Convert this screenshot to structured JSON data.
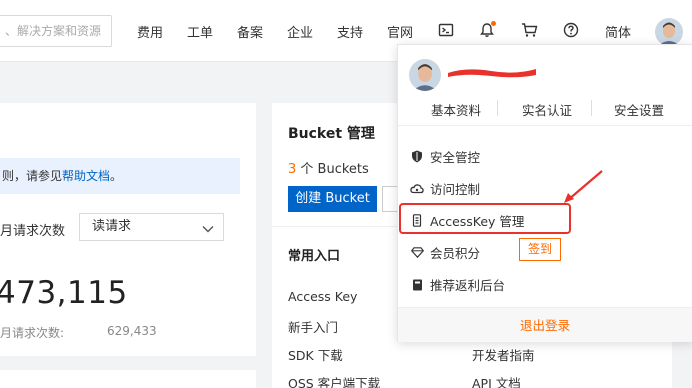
{
  "topbar": {
    "search_placeholder": "、解决方案和资源",
    "nav": [
      "费用",
      "工单",
      "备案",
      "企业",
      "支持",
      "官网"
    ],
    "lang": "简体",
    "icons": [
      "terminal-icon",
      "bell-icon",
      "cart-icon",
      "help-icon"
    ]
  },
  "left_card": {
    "info_text_pre": "则，请参见",
    "info_link": "帮助文档",
    "info_text_post": "。",
    "req_label": "月请求次数",
    "req_select": "读请求",
    "big_number": "473,115",
    "sub_label": "月请求次数:",
    "sub_value": "629,433"
  },
  "right_card": {
    "title": "Bucket 管理",
    "count_num": "3",
    "count_text": " 个 Buckets",
    "create_button": "创建 Bucket",
    "common_title": "常用入口",
    "links": {
      "access_key": "Access Key",
      "new_user": "新手入门",
      "sdk": "SDK 下载",
      "oss_client": "OSS 客户端下载",
      "dev_guide": "开发者指南",
      "api_doc": "API 文档"
    }
  },
  "dropdown": {
    "links": [
      "基本资料",
      "实名认证",
      "安全设置"
    ],
    "items": [
      {
        "label": "安全管控",
        "icon": "shield-icon"
      },
      {
        "label": "访问控制",
        "icon": "cloud-key-icon"
      },
      {
        "label": "AccessKey 管理",
        "icon": "key-icon"
      },
      {
        "label": "会员积分",
        "icon": "diamond-icon"
      },
      {
        "label": "推荐返利后台",
        "icon": "book-icon"
      }
    ],
    "sign_button": "签到",
    "logout": "退出登录"
  },
  "colors": {
    "accent": "#ff6a00",
    "primary": "#0064c8",
    "annotation": "#e8322b"
  }
}
